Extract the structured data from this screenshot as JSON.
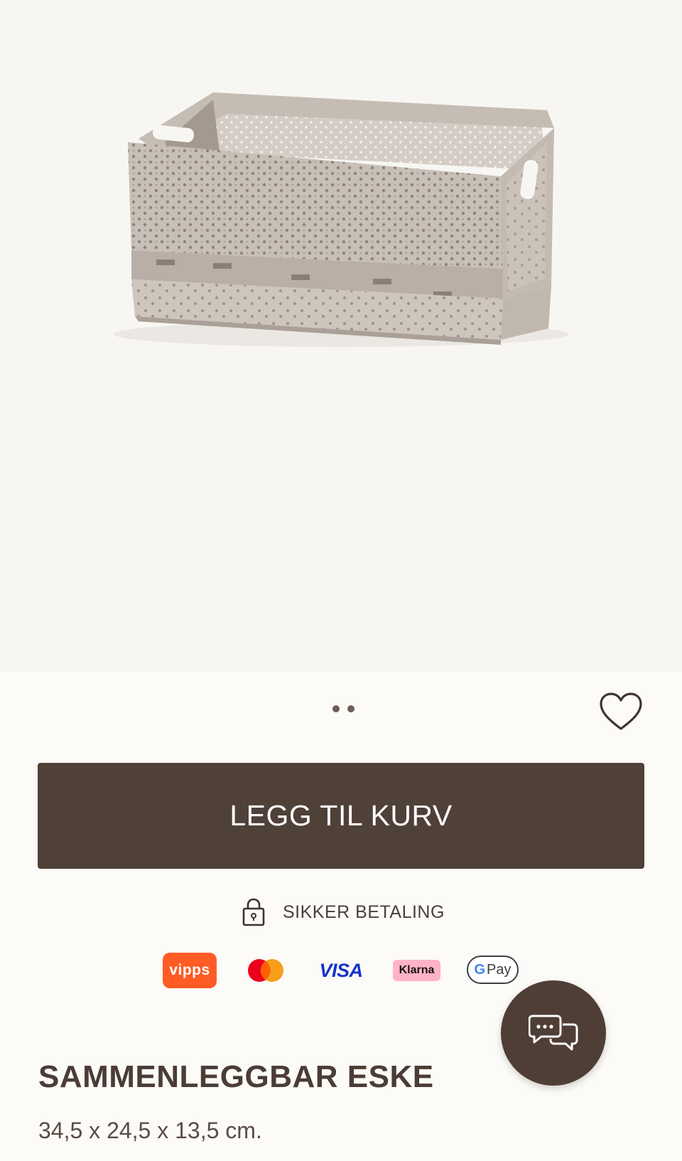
{
  "product": {
    "image_alt": "product-basket-image",
    "title": "SAMMENLEGGBAR ESKE",
    "dimensions": "34,5 x 24,5 x 13,5 cm."
  },
  "carousel": {
    "dot_count": 2
  },
  "actions": {
    "add_to_cart_label": "LEGG TIL KURV",
    "favorite_icon": "heart-icon"
  },
  "secure_payment": {
    "label": "SIKKER BETALING",
    "icon": "lock-icon"
  },
  "payment_methods": {
    "vipps": "vipps",
    "mastercard": "mastercard-logo",
    "visa": "VISA",
    "klarna": "Klarna",
    "gpay": "Pay"
  },
  "chat": {
    "icon": "chat-bubbles-icon"
  },
  "colors": {
    "primary_brown": "#4f4038",
    "background": "#fcfbf7",
    "image_background": "#f7f6f2",
    "basket_color": "#c9c0b8"
  }
}
